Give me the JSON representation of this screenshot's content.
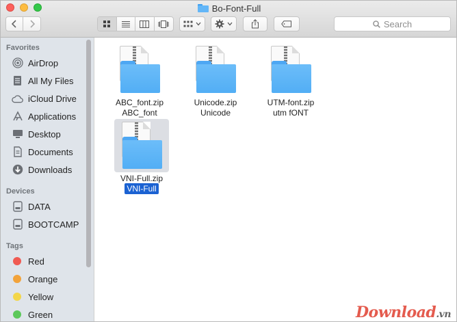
{
  "window": {
    "title": "Bo-Font-Full"
  },
  "toolbar": {
    "back_icon": "chevron-left-icon",
    "forward_icon": "chevron-right-icon",
    "view_modes": [
      "icon-view",
      "list-view",
      "column-view",
      "cover-flow-view"
    ],
    "active_view": "icon-view",
    "search_placeholder": "Search"
  },
  "sidebar": {
    "favorites_heading": "Favorites",
    "favorites": [
      {
        "label": "AirDrop",
        "icon": "airdrop-icon"
      },
      {
        "label": "All My Files",
        "icon": "all-files-icon"
      },
      {
        "label": "iCloud Drive",
        "icon": "cloud-icon"
      },
      {
        "label": "Applications",
        "icon": "applications-icon"
      },
      {
        "label": "Desktop",
        "icon": "desktop-icon"
      },
      {
        "label": "Documents",
        "icon": "documents-icon"
      },
      {
        "label": "Downloads",
        "icon": "downloads-icon"
      }
    ],
    "devices_heading": "Devices",
    "devices": [
      {
        "label": "DATA",
        "icon": "disk-icon"
      },
      {
        "label": "BOOTCAMP",
        "icon": "disk-icon"
      }
    ],
    "tags_heading": "Tags",
    "tags": [
      {
        "label": "Red",
        "color": "#f05a52"
      },
      {
        "label": "Orange",
        "color": "#f2a33b"
      },
      {
        "label": "Yellow",
        "color": "#f3d64a"
      },
      {
        "label": "Green",
        "color": "#5cc85a"
      }
    ]
  },
  "files": [
    {
      "zip": "ABC_font.zip",
      "folder": "ABC_font",
      "selected": false
    },
    {
      "zip": "Unicode.zip",
      "folder": "Unicode",
      "selected": false
    },
    {
      "zip": "UTM-font.zip",
      "folder": "utm fONT",
      "selected": false
    },
    {
      "zip": "VNI-Full.zip",
      "folder": "VNI-Full",
      "selected": true
    }
  ],
  "watermark": {
    "text": "Download",
    "suffix": ".vn"
  }
}
